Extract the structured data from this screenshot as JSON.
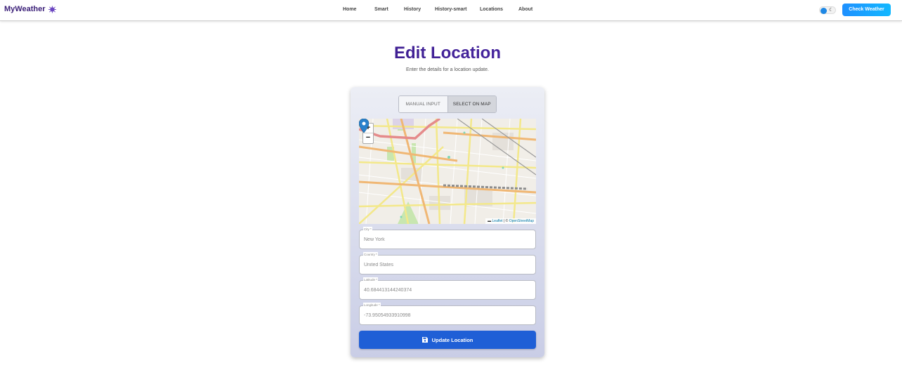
{
  "nav": {
    "brand": "MyWeather",
    "links": [
      "Home",
      "Smart",
      "History",
      "History-smart",
      "Locations",
      "About"
    ],
    "check_weather_label": "Check Weather",
    "theme_toggle_icon": "moon-icon"
  },
  "header": {
    "title": "Edit Location",
    "subtitle": "Enter the details for a location update."
  },
  "form": {
    "modes": [
      "MANUAL INPUT",
      "SELECT ON MAP"
    ],
    "active_mode": "SELECT ON MAP",
    "map": {
      "zoom_in": "+",
      "zoom_out": "−",
      "attribution_leaflet": "Leaflet",
      "attribution_sep": " | © ",
      "attribution_osm": "OpenStreetMap"
    },
    "fields": {
      "city": {
        "label": "City *",
        "value": "New York"
      },
      "country": {
        "label": "Country *",
        "value": "United States"
      },
      "latitude": {
        "label": "Latitude *",
        "value": "40.684413144240374"
      },
      "longitude": {
        "label": "Longitude *",
        "value": "-73.95054933910998"
      }
    },
    "submit_label": "Update Location"
  },
  "colors": {
    "brand": "#3b1f78",
    "accent": "#1e90ff",
    "submit": "#1f5fd6"
  }
}
